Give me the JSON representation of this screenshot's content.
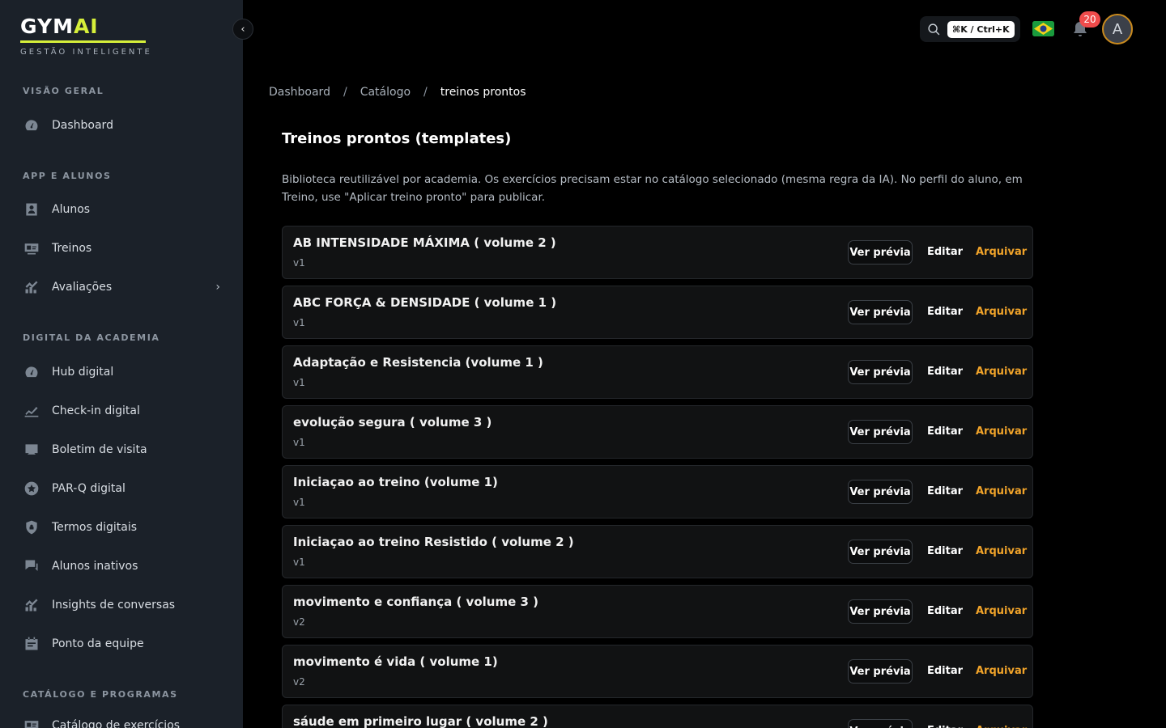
{
  "brand": {
    "name_part1": "GYM",
    "name_part2": "AI",
    "subtitle": "GESTÃO INTELIGENTE",
    "accent_color": "#d6ef3a"
  },
  "sidebar": {
    "collapse_icon": "chevron-left-icon",
    "sections": [
      {
        "label": "VISÃO GERAL",
        "items": [
          {
            "label": "Dashboard",
            "icon": "gauge-icon"
          }
        ]
      },
      {
        "label": "APP E ALUNOS",
        "items": [
          {
            "label": "Alunos",
            "icon": "user-icon"
          },
          {
            "label": "Treinos",
            "icon": "id-card-icon"
          },
          {
            "label": "Avaliações",
            "icon": "chart-icon",
            "has_submenu": true
          }
        ]
      },
      {
        "label": "DIGITAL DA ACADEMIA",
        "items": [
          {
            "label": "Hub digital",
            "icon": "gauge-icon"
          },
          {
            "label": "Check-in digital",
            "icon": "checkin-icon"
          },
          {
            "label": "Boletim de visita",
            "icon": "board-icon"
          },
          {
            "label": "PAR-Q digital",
            "icon": "star-badge-icon"
          },
          {
            "label": "Termos digitais",
            "icon": "lock-icon"
          },
          {
            "label": "Alunos inativos",
            "icon": "chat-icon"
          },
          {
            "label": "Insights de conversas",
            "icon": "chart-icon"
          },
          {
            "label": "Ponto da equipe",
            "icon": "calendar-icon"
          }
        ]
      },
      {
        "label": "CATÁLOGO E PROGRAMAS",
        "items": [
          {
            "label": "Catálogo de exercícios",
            "icon": "id-card-icon"
          }
        ]
      }
    ]
  },
  "topbar": {
    "search_shortcut": "⌘K / Ctrl+K",
    "notifications_count": "20",
    "avatar_initial": "A",
    "flag": "brazil-flag-icon"
  },
  "breadcrumb": [
    "Dashboard",
    "Catálogo",
    "treinos prontos"
  ],
  "page": {
    "title": "Treinos prontos (templates)",
    "description": "Biblioteca reutilizável por academia. Os exercícios precisam estar no catálogo selecionado (mesma regra da IA). No perfil do aluno, em Treino, use \"Aplicar treino pronto\" para publicar."
  },
  "actions": {
    "preview_label": "Ver prévia",
    "edit_label": "Editar",
    "archive_label": "Arquivar",
    "archive_color": "#f0a32a"
  },
  "templates": [
    {
      "name": "AB INTENSIDADE MÁXIMA ( volume 2 )",
      "version": "v1"
    },
    {
      "name": "ABC FORÇA & DENSIDADE ( volume 1 )",
      "version": "v1"
    },
    {
      "name": "Adaptação e Resistencia (volume 1 )",
      "version": "v1"
    },
    {
      "name": "evolução segura ( volume 3 )",
      "version": "v1"
    },
    {
      "name": "Iniciaçao ao treino (volume 1)",
      "version": "v1"
    },
    {
      "name": "Iniciaçao ao treino Resistido ( volume 2 )",
      "version": "v1"
    },
    {
      "name": "movimento e confiança ( volume 3 )",
      "version": "v2"
    },
    {
      "name": "movimento é vida ( volume 1)",
      "version": "v2"
    },
    {
      "name": "sáude em primeiro lugar ( volume 2 )",
      "version": ""
    }
  ]
}
